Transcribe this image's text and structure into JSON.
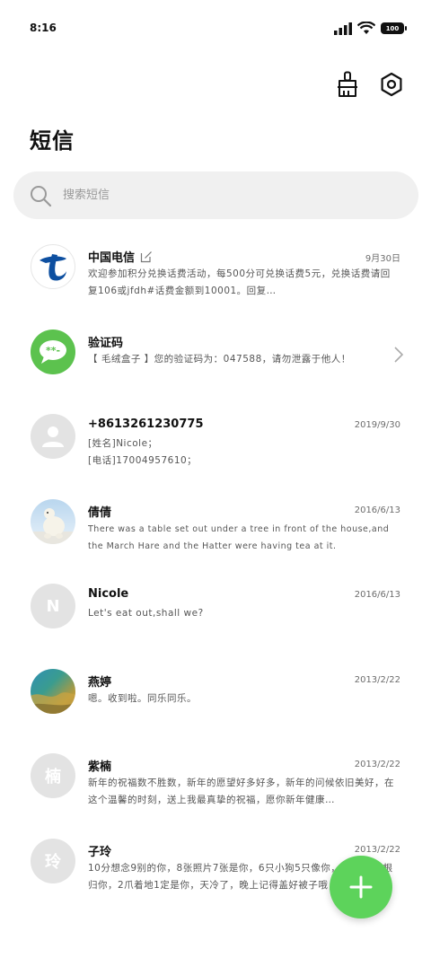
{
  "status": {
    "time": "8:16",
    "battery": "100"
  },
  "header": {
    "title": "短信"
  },
  "search": {
    "placeholder": "搜索短信"
  },
  "messages": [
    {
      "name": "中国电信",
      "date": "9月30日",
      "preview": "欢迎参加积分兑换话费活动，每500分可兑换话费5元，兑换话费请回复106或jfdh#话费金额到10001。回复…",
      "avatar": "china-telecom-logo"
    },
    {
      "name": "验证码",
      "date": "",
      "preview": "【 毛绒盒子 】您的验证码为：047588，请勿泄露于他人！",
      "avatar": "sms-bubble-icon"
    },
    {
      "name": "+8613261230775",
      "date": "2019/9/30",
      "preview": "[姓名]Nicole；\n[电话]17004957610；",
      "avatar": "person-icon"
    },
    {
      "name": "倩倩",
      "date": "2016/6/13",
      "preview": "There was a table set out under a tree in front of the house,and the March Hare and the Hatter were having tea at it.",
      "avatar": "polar-bear-photo"
    },
    {
      "name": "Nicole",
      "date": "2016/6/13",
      "preview": "Let's eat out,shall we?",
      "avatar_letter": "N"
    },
    {
      "name": "燕婷",
      "date": "2013/2/22",
      "preview": "嗯。收到啦。同乐同乐。",
      "avatar": "landscape-photo"
    },
    {
      "name": "紫楠",
      "date": "2013/2/22",
      "preview": "新年的祝福数不胜数，新年的愿望好多好多，新年的问候依旧美好，在这个温馨的时刻，送上我最真挚的祝福，愿你新年健康…",
      "avatar_letter": "楠"
    },
    {
      "name": "子玲",
      "date": "2013/2/22",
      "preview": "10分想念9别的你，8张照片7张是你，6只小狗5只像你，4根骨头3根归你，2爪着地1定是你，天冷了，晚上记得盖好被子哦，乐…",
      "avatar_letter": "玲"
    }
  ],
  "colors": {
    "accent": "#5dd35b",
    "telecom_blue": "#0d4fa0",
    "avatar_gray": "#e3e3e3"
  }
}
